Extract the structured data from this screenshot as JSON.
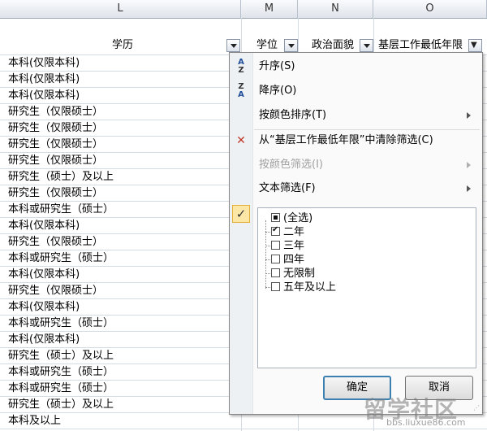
{
  "column_headers": [
    "L",
    "M",
    "N",
    "O"
  ],
  "header_row": {
    "education": "学历",
    "degree": "学位",
    "political": "政治面貌",
    "min_years": "基层工作最低年限"
  },
  "rows": [
    "本科(仅限本科)",
    "本科(仅限本科)",
    "本科(仅限本科)",
    "研究生（仅限硕士）",
    "研究生（仅限硕士）",
    "研究生（仅限硕士）",
    "研究生（仅限硕士）",
    "研究生（硕士）及以上",
    "研究生（仅限硕士）",
    "本科或研究生（硕士）",
    "本科(仅限本科)",
    "研究生（仅限硕士）",
    "本科或研究生（硕士）",
    "本科(仅限本科)",
    "研究生（仅限硕士）",
    "本科(仅限本科)",
    "本科或研究生（硕士）",
    "本科(仅限本科)",
    "研究生（硕士）及以上",
    "本科或研究生（硕士）",
    "本科或研究生（硕士）",
    "研究生（硕士）及以上",
    "本科及以上"
  ],
  "menu": {
    "sort_asc": "升序(S)",
    "sort_desc": "降序(O)",
    "sort_by_color": "按颜色排序(T)",
    "clear_filter": "从“基层工作最低年限”中清除筛选(C)",
    "filter_by_color": "按颜色筛选(I)",
    "text_filter": "文本筛选(F)",
    "ok": "确定",
    "cancel": "取消"
  },
  "filter_list": [
    {
      "label": "(全选)",
      "state": "mixed"
    },
    {
      "label": "二年",
      "state": "checked"
    },
    {
      "label": "三年",
      "state": "unchecked"
    },
    {
      "label": "四年",
      "state": "unchecked"
    },
    {
      "label": "无限制",
      "state": "unchecked"
    },
    {
      "label": "五年及以上",
      "state": "unchecked"
    }
  ],
  "watermark": {
    "text": "留学社区",
    "url": "bbs.liuxue86.com"
  },
  "colors": {
    "accent": "#3c7fb1",
    "check_highlight": "#fde7a6"
  }
}
